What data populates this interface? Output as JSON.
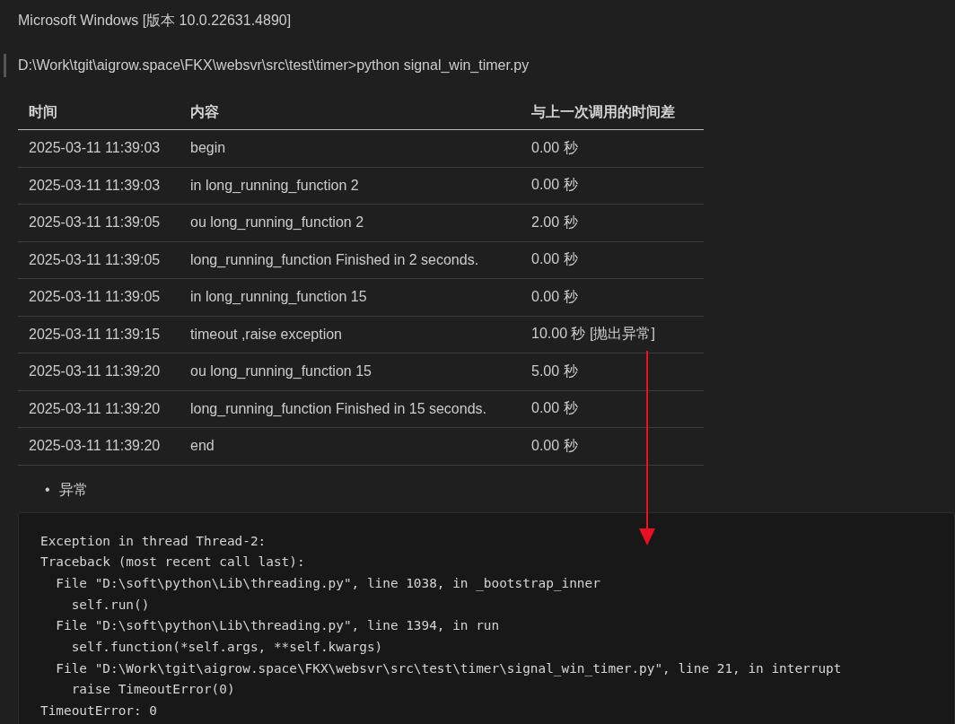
{
  "header_line": "Microsoft Windows [版本 10.0.22631.4890]",
  "command_line": "D:\\Work\\tgit\\aigrow.space\\FKX\\websvr\\src\\test\\timer>python signal_win_timer.py",
  "table": {
    "columns": [
      "时间",
      "内容",
      "与上一次调用的时间差"
    ],
    "rows": [
      [
        "2025-03-11 11:39:03",
        "begin",
        "0.00 秒"
      ],
      [
        "2025-03-11 11:39:03",
        "in long_running_function 2",
        "0.00 秒"
      ],
      [
        "2025-03-11 11:39:05",
        "ou long_running_function 2",
        "2.00 秒"
      ],
      [
        "2025-03-11 11:39:05",
        "long_running_function Finished in 2 seconds.",
        "0.00 秒"
      ],
      [
        "2025-03-11 11:39:05",
        "in long_running_function 15",
        "0.00 秒"
      ],
      [
        "2025-03-11 11:39:15",
        "timeout ,raise exception",
        "10.00 秒 [抛出异常]"
      ],
      [
        "2025-03-11 11:39:20",
        "ou long_running_function 15",
        "5.00 秒"
      ],
      [
        "2025-03-11 11:39:20",
        "long_running_function Finished in 15 seconds.",
        "0.00 秒"
      ],
      [
        "2025-03-11 11:39:20",
        "end",
        "0.00 秒"
      ]
    ]
  },
  "bullets": [
    {
      "marker": "•",
      "text": "异常"
    }
  ],
  "code_lines": [
    "Exception in thread Thread-2:",
    "Traceback (most recent call last):",
    "  File \"D:\\soft\\python\\Lib\\threading.py\", line 1038, in _bootstrap_inner",
    "    self.run()",
    "  File \"D:\\soft\\python\\Lib\\threading.py\", line 1394, in run",
    "    self.function(*self.args, **self.kwargs)",
    "  File \"D:\\Work\\tgit\\aigrow.space\\FKX\\websvr\\src\\test\\timer\\signal_win_timer.py\", line 21, in interrupt",
    "    raise TimeoutError(0)",
    "TimeoutError: 0"
  ]
}
